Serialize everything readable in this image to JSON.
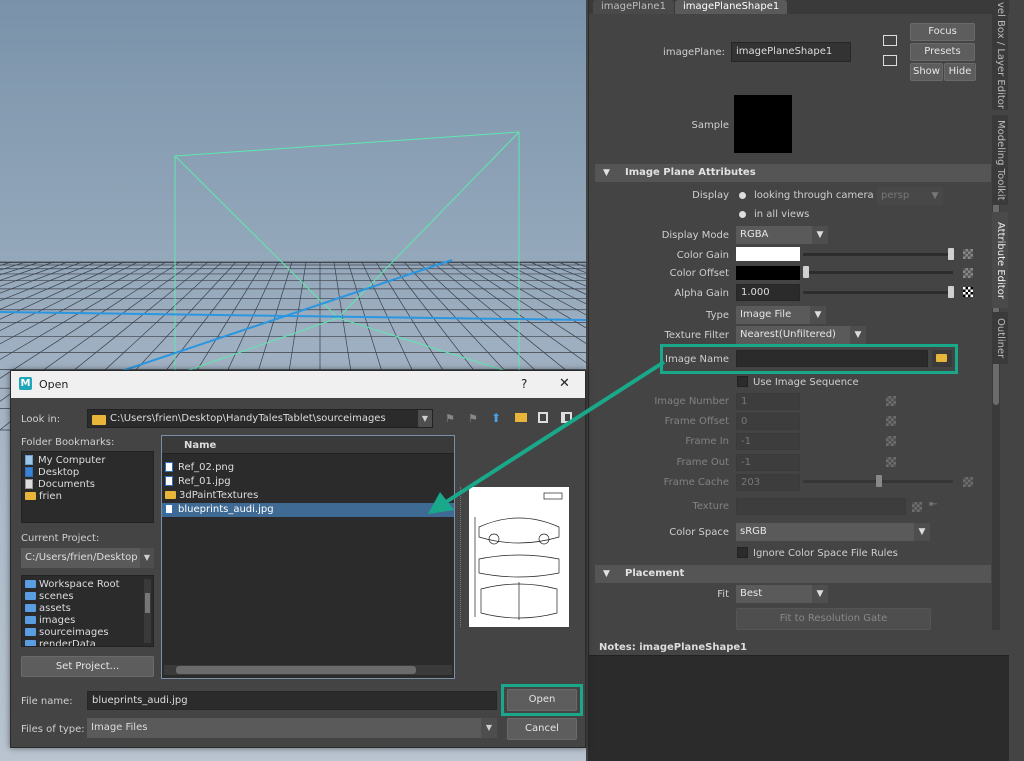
{
  "colors": {
    "accent_teal": "#19a889",
    "selection_blue": "#3f6a94",
    "viewport_line": "#2a96e0",
    "camera_green": "#5ee8b0"
  },
  "attribute_editor": {
    "tabs": [
      "imagePlane1",
      "imagePlaneShape1"
    ],
    "image_plane_label": "imagePlane:",
    "image_plane_value": "imagePlaneShape1",
    "focus": "Focus",
    "presets": "Presets",
    "show": "Show",
    "hide": "Hide",
    "sample_label": "Sample",
    "section_attributes": "Image Plane Attributes",
    "display_label": "Display",
    "display_opt1": "looking through camera",
    "display_camera": "persp",
    "display_opt2": "in all views",
    "display_mode_label": "Display Mode",
    "display_mode_value": "RGBA",
    "color_gain_label": "Color Gain",
    "color_offset_label": "Color Offset",
    "alpha_gain_label": "Alpha Gain",
    "alpha_gain_value": "1.000",
    "type_label": "Type",
    "type_value": "Image File",
    "texture_filter_label": "Texture Filter",
    "texture_filter_value": "Nearest(Unfiltered)",
    "image_name_label": "Image Name",
    "image_name_value": "",
    "use_sequence_label": "Use Image Sequence",
    "image_number_label": "Image Number",
    "image_number_value": "1",
    "frame_offset_label": "Frame Offset",
    "frame_offset_value": "0",
    "frame_in_label": "Frame In",
    "frame_in_value": "-1",
    "frame_out_label": "Frame Out",
    "frame_out_value": "-1",
    "frame_cache_label": "Frame Cache",
    "frame_cache_value": "203",
    "texture_label": "Texture",
    "color_space_label": "Color Space",
    "color_space_value": "sRGB",
    "ignore_rules_label": "Ignore Color Space File Rules",
    "section_placement": "Placement",
    "fit_label": "Fit",
    "fit_value": "Best",
    "fit_resolution_label": "Fit to Resolution Gate",
    "notes_label": "Notes:  imagePlaneShape1"
  },
  "side_tabs": [
    "vel Box / Layer Editor",
    "Modeling Toolkit",
    "Attribute Editor",
    "Outliner"
  ],
  "dialog": {
    "title": "Open",
    "help": "?",
    "close": "✕",
    "look_in_label": "Look in:",
    "look_in_path": "C:\\Users\\frien\\Desktop\\HandyTalesTablet\\sourceimages",
    "bookmarks_label": "Folder Bookmarks:",
    "bookmarks": [
      "My Computer",
      "Desktop",
      "Documents",
      "frien"
    ],
    "current_project_label": "Current Project:",
    "current_project_value": "C:/Users/frien/Desktop",
    "project_folders": [
      "Workspace Root",
      "scenes",
      "assets",
      "images",
      "sourceimages",
      "renderData"
    ],
    "set_project": "Set Project...",
    "name_header": "Name",
    "files": [
      {
        "name": "Ref_02.png",
        "kind": "file"
      },
      {
        "name": "Ref_01.jpg",
        "kind": "file"
      },
      {
        "name": "3dPaintTextures",
        "kind": "folder"
      },
      {
        "name": "blueprints_audi.jpg",
        "kind": "file"
      }
    ],
    "file_name_label": "File name:",
    "file_name_value": "blueprints_audi.jpg",
    "files_of_type_label": "Files of type:",
    "files_of_type_value": "Image Files",
    "open": "Open",
    "cancel": "Cancel"
  }
}
